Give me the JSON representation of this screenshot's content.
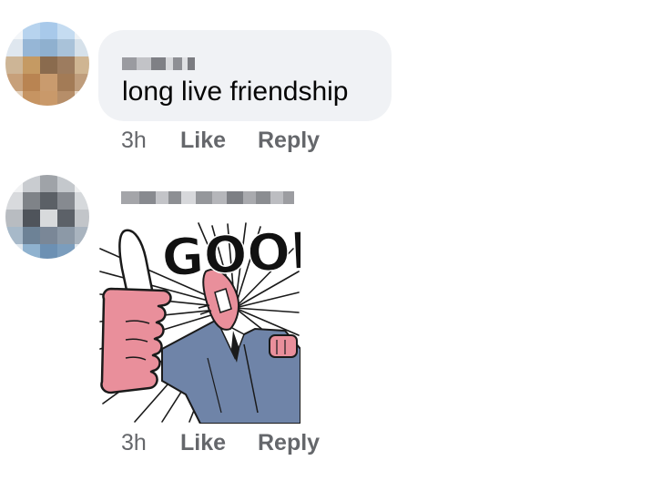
{
  "comments": [
    {
      "author_name": "",
      "text": "long live friendship",
      "time": "3h",
      "like_label": "Like",
      "reply_label": "Reply"
    },
    {
      "author_name": "",
      "sticker": {
        "text": "GOOD",
        "description": "cartoon man giving a big thumbs up"
      },
      "time": "3h",
      "like_label": "Like",
      "reply_label": "Reply"
    }
  ],
  "colors": {
    "bubble_background": "#f0f2f5",
    "action_text": "#65676b",
    "sticker_suit": "#6f84a8",
    "sticker_hand": "#e98f9b"
  }
}
